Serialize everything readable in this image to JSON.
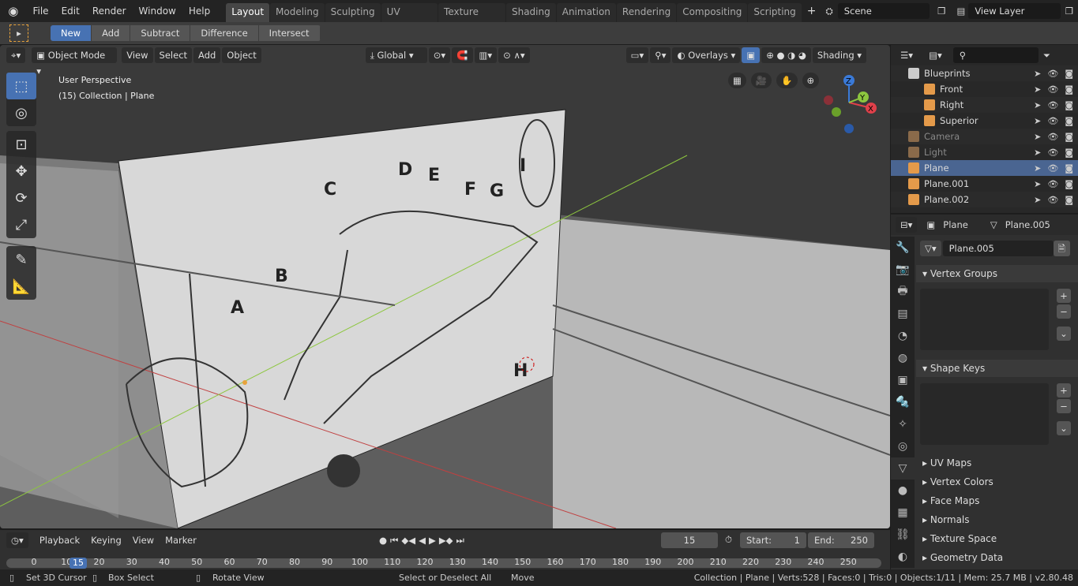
{
  "topbar": {
    "menus": [
      "File",
      "Edit",
      "Render",
      "Window",
      "Help"
    ],
    "tabs": [
      "Layout",
      "Modeling",
      "Sculpting",
      "UV Editing",
      "Texture Paint",
      "Shading",
      "Animation",
      "Rendering",
      "Compositing",
      "Scripting"
    ],
    "active_tab": "Layout",
    "add_tab": "+",
    "scene": "Scene",
    "view_layer": "View Layer"
  },
  "toolsettings": {
    "modes": [
      "New",
      "Add",
      "Subtract",
      "Difference",
      "Intersect"
    ],
    "active": "New"
  },
  "viewport": {
    "mode": "Object Mode",
    "menus": [
      "View",
      "Select",
      "Add",
      "Object"
    ],
    "orientation": "Global",
    "overlays": "Overlays",
    "shading": "Shading",
    "info_line1": "User Perspective",
    "info_line2": "(15) Collection | Plane",
    "gizmo": {
      "x": "X",
      "y": "Y",
      "z": "Z"
    },
    "blueprint_labels": [
      "A",
      "B",
      "C",
      "D",
      "E",
      "F",
      "G",
      "H",
      "I"
    ]
  },
  "outliner": {
    "items": [
      {
        "name": "Blueprints",
        "type": "collection",
        "color": "#cccccc"
      },
      {
        "name": "Front",
        "type": "image",
        "color": "#e49a4a"
      },
      {
        "name": "Right",
        "type": "image",
        "color": "#e49a4a"
      },
      {
        "name": "Superior",
        "type": "image",
        "color": "#e49a4a"
      },
      {
        "name": "Camera",
        "type": "camera",
        "color": "#8a6a4a",
        "dim": true
      },
      {
        "name": "Light",
        "type": "light",
        "color": "#8a6a4a",
        "dim": true
      },
      {
        "name": "Plane",
        "type": "mesh",
        "color": "#e49a4a",
        "selected": true
      },
      {
        "name": "Plane.001",
        "type": "mesh",
        "color": "#e49a4a"
      },
      {
        "name": "Plane.002",
        "type": "mesh",
        "color": "#e49a4a"
      }
    ]
  },
  "properties": {
    "object": "Plane",
    "mesh": "Plane.005",
    "datablock": "Plane.005",
    "panels": [
      "Vertex Groups",
      "Shape Keys",
      "UV Maps",
      "Vertex Colors",
      "Face Maps",
      "Normals",
      "Texture Space",
      "Geometry Data"
    ]
  },
  "timeline": {
    "menus": [
      "Playback",
      "Keying",
      "View",
      "Marker"
    ],
    "current_frame": "15",
    "start_label": "Start:",
    "start": "1",
    "end_label": "End:",
    "end": "250",
    "ticks": [
      "0",
      "10",
      "20",
      "30",
      "40",
      "50",
      "60",
      "70",
      "80",
      "90",
      "100",
      "110",
      "120",
      "130",
      "140",
      "150",
      "160",
      "170",
      "180",
      "190",
      "200",
      "210",
      "220",
      "230",
      "240",
      "250"
    ]
  },
  "status": {
    "left": [
      "Set 3D Cursor",
      "Box Select",
      "Rotate View"
    ],
    "mid": [
      "Select or Deselect All",
      "Move"
    ],
    "info": "Collection | Plane | Verts:528 | Faces:0 | Tris:0 | Objects:1/11 | Mem: 25.7 MB | v2.80.48"
  },
  "colors": {
    "accent": "#4772b3",
    "x_axis": "#e0404a",
    "y_axis": "#8dc63f",
    "z_axis": "#3a7ad8"
  }
}
